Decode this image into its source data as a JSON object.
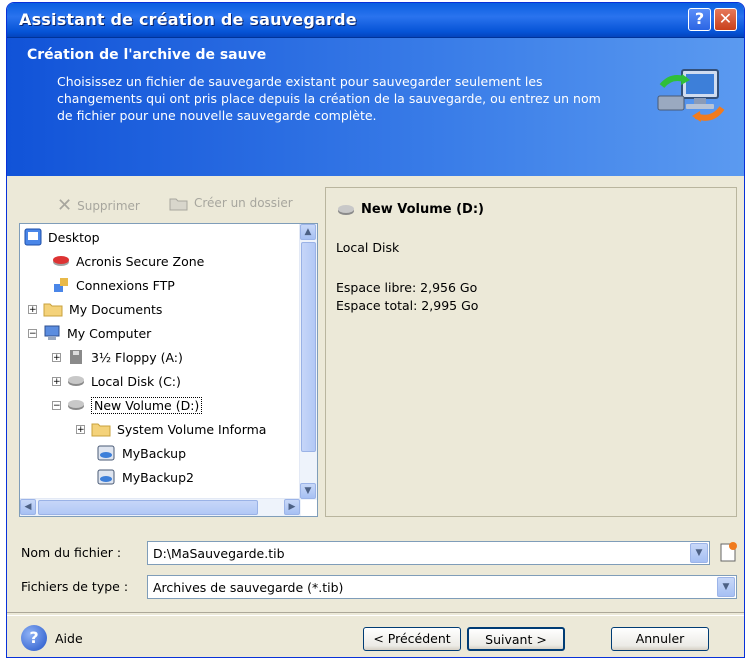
{
  "window": {
    "title": "Assistant de création de sauvegarde",
    "help_button": "?",
    "close_button": "✕"
  },
  "header": {
    "title": "Création de l'archive de sauve",
    "description": "Choisissez un fichier de sauvegarde existant pour sauvegarder seulement les changements qui ont pris place depuis la création de la sauvegarde, ou entrez un nom de fichier pour une nouvelle sauvegarde complète."
  },
  "toolbar": {
    "delete_label": "Supprimer",
    "new_folder_label": "Créer un dossier"
  },
  "tree": {
    "items": [
      {
        "label": "Desktop"
      },
      {
        "label": "Acronis Secure Zone"
      },
      {
        "label": "Connexions FTP"
      },
      {
        "label": "My Documents"
      },
      {
        "label": "My Computer"
      },
      {
        "label": "3½ Floppy (A:)"
      },
      {
        "label": "Local Disk (C:)"
      },
      {
        "label": "New Volume (D:)"
      },
      {
        "label": "System Volume Informa"
      },
      {
        "label": "MyBackup"
      },
      {
        "label": "MyBackup2"
      }
    ]
  },
  "details": {
    "title": "New Volume (D:)",
    "type": "Local Disk",
    "free_space": "Espace libre: 2,956 Go",
    "total_space": "Espace total: 2,995 Go"
  },
  "form": {
    "filename_label": "Nom du fichier :",
    "filename_value": "D:\\MaSauvegarde.tib",
    "filetype_label": "Fichiers de type :",
    "filetype_value": "Archives de sauvegarde (*.tib)"
  },
  "footer": {
    "help_label": "Aide",
    "back_label": "< Précédent",
    "next_label": "Suivant >",
    "cancel_label": "Annuler"
  },
  "colors": {
    "title_bar": "#0A5FE0",
    "header": "#1153D8",
    "dialog_bg": "#ECE9D8"
  }
}
